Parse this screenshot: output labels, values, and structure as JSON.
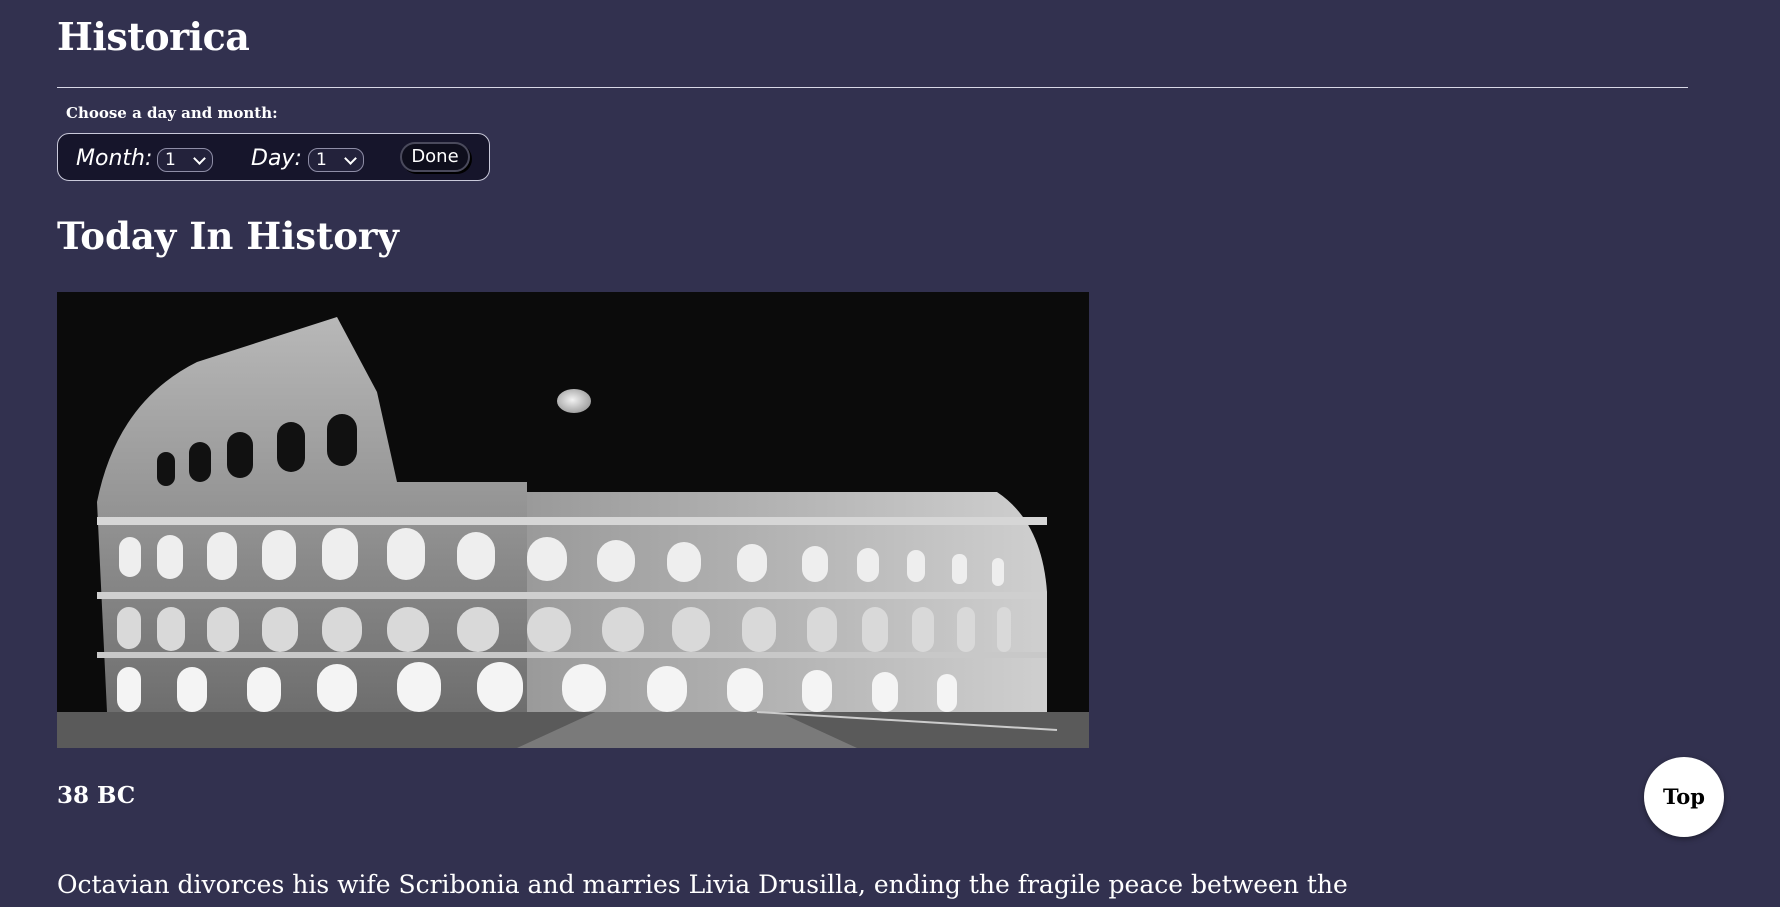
{
  "header": {
    "title": "Historica"
  },
  "picker": {
    "label": "Choose a day and month:",
    "month_label": "Month:",
    "month_value": "1",
    "day_label": "Day:",
    "day_value": "1",
    "done_label": "Done"
  },
  "section": {
    "title": "Today In History"
  },
  "hero": {
    "alt": "Colosseum at night, black and white photograph with moon"
  },
  "event": {
    "year": "38 BC",
    "text": "Octavian divorces his wife Scribonia and marries Livia Drusilla, ending the fragile peace between the"
  },
  "top_button": {
    "label": "Top"
  }
}
